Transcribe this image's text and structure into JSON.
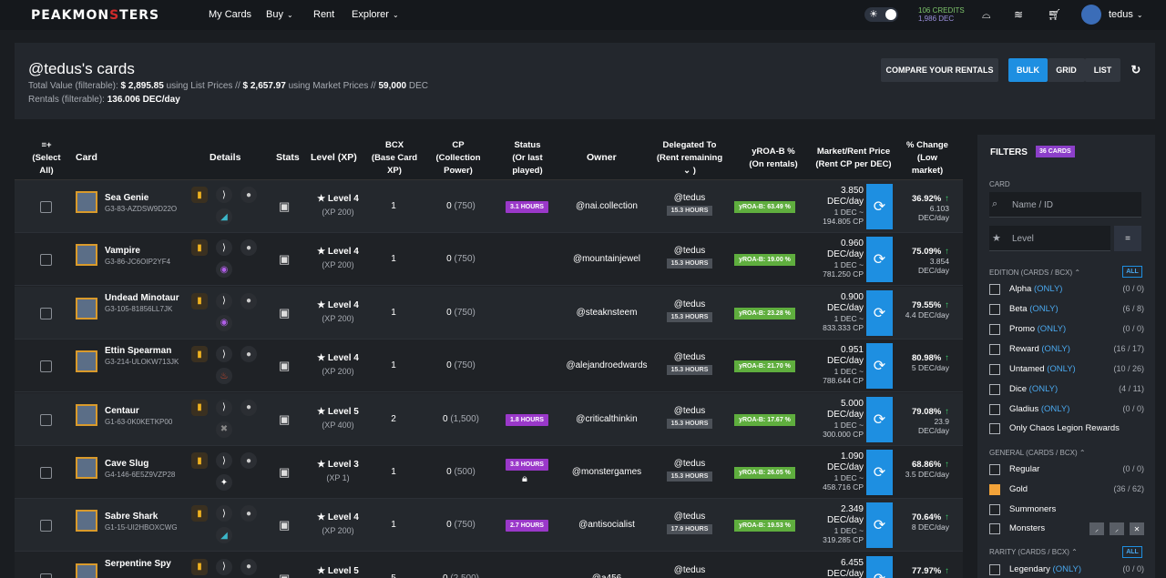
{
  "nav": {
    "logo": "PEAKMONSTERS",
    "logo_pre": "PEAKMON",
    "logo_mid": "S",
    "logo_post": "TERS",
    "my_cards": "My Cards",
    "buy": "Buy",
    "rent": "Rent",
    "explorer": "Explorer",
    "credits": "106 CREDITS",
    "dec": "1,986 DEC",
    "username": "tedus"
  },
  "header": {
    "title": "@tedus's cards",
    "total_label": "Total Value (filterable):",
    "list_value": "$ 2,895.85",
    "list_label": "using List Prices //",
    "market_value": "$ 2,657.97",
    "market_label": "using Market Prices //",
    "dec_value": "59,000",
    "dec_label": "DEC",
    "rentals_label": "Rentals (filterable):",
    "rentals_value": "136.006 DEC/day",
    "compare_btn": "COMPARE YOUR RENTALS",
    "bulk": "BULK",
    "grid": "GRID",
    "list": "LIST"
  },
  "table": {
    "headers": {
      "select": "≡+\n(Select\nAll)",
      "card": "Card",
      "details": "Details",
      "stats": "Stats",
      "level": "Level (XP)",
      "bcx": "BCX\n(Base Card\nXP)",
      "cp": "CP\n(Collection\nPower)",
      "status": "Status\n(Or last\nplayed)",
      "owner": "Owner",
      "delegated": "Delegated To\n(Rent remaining\n⌄ )",
      "yroa": "yROA-B %\n(On rentals)",
      "price": "Market/Rent Price\n(Rent CP per DEC)",
      "change": "% Change\n(Low\nmarket)"
    },
    "rows": [
      {
        "name": "Sea Genie",
        "id": "G3-83-AZDSW9D22O",
        "level": "Level 4",
        "xp": "(XP 200)",
        "bcx": "1",
        "cp": "0",
        "cp2": "(750)",
        "status": "3.1 HOURS",
        "owner": "@nai.collection",
        "deleg": "@tedus",
        "hours": "15.3 HOURS",
        "yroa": "yROA-B: 63.49 %",
        "price": "3.850",
        "p2": "DEC/day",
        "p3": "1 DEC ~",
        "p4": "194.805 CP",
        "pct": "36.92%",
        "pct2": "6.103",
        "pct3": "DEC/day"
      },
      {
        "name": "Vampire",
        "id": "G3-86-JC6OIP2YF4",
        "level": "Level 4",
        "xp": "(XP 200)",
        "bcx": "1",
        "cp": "0",
        "cp2": "(750)",
        "status": "",
        "owner": "@mountainjewel",
        "deleg": "@tedus",
        "hours": "15.3 HOURS",
        "yroa": "yROA-B: 19.00 %",
        "price": "0.960",
        "p2": "DEC/day",
        "p3": "1 DEC ~",
        "p4": "781.250 CP",
        "pct": "75.09%",
        "pct2": "3.854",
        "pct3": "DEC/day"
      },
      {
        "name": "Undead Minotaur",
        "id": "G3-105-81856LL7JK",
        "level": "Level 4",
        "xp": "(XP 200)",
        "bcx": "1",
        "cp": "0",
        "cp2": "(750)",
        "status": "",
        "owner": "@steaknsteem",
        "deleg": "@tedus",
        "hours": "15.3 HOURS",
        "yroa": "yROA-B: 23.28 %",
        "price": "0.900",
        "p2": "DEC/day",
        "p3": "1 DEC ~",
        "p4": "833.333 CP",
        "pct": "79.55%",
        "pct2": "4.4 DEC/day",
        "pct3": ""
      },
      {
        "name": "Ettin Spearman",
        "id": "G3-214-ULOKW713JK",
        "level": "Level 4",
        "xp": "(XP 200)",
        "bcx": "1",
        "cp": "0",
        "cp2": "(750)",
        "status": "",
        "owner": "@alejandroedwards",
        "deleg": "@tedus",
        "hours": "15.3 HOURS",
        "yroa": "yROA-B: 21.70 %",
        "price": "0.951",
        "p2": "DEC/day",
        "p3": "1 DEC ~",
        "p4": "788.644 CP",
        "pct": "80.98%",
        "pct2": "5 DEC/day",
        "pct3": ""
      },
      {
        "name": "Centaur",
        "id": "G1-63-0K0KETKP00",
        "level": "Level 5",
        "xp": "(XP 400)",
        "bcx": "2",
        "cp": "0",
        "cp2": "(1,500)",
        "status": "1.8 HOURS",
        "owner": "@criticalthinkin",
        "deleg": "@tedus",
        "hours": "15.3 HOURS",
        "yroa": "yROA-B: 17.67 %",
        "price": "5.000",
        "p2": "DEC/day",
        "p3": "1 DEC ~",
        "p4": "300.000 CP",
        "pct": "79.08%",
        "pct2": "23.9",
        "pct3": "DEC/day"
      },
      {
        "name": "Cave Slug",
        "id": "G4-146-6E5Z9VZP28",
        "level": "Level 3",
        "xp": "(XP 1)",
        "bcx": "1",
        "cp": "0",
        "cp2": "(500)",
        "status": "3.8 HOURS",
        "owner": "@monstergames",
        "deleg": "@tedus",
        "hours": "15.3 HOURS",
        "yroa": "yROA-B: 26.05 %",
        "price": "1.090",
        "p2": "DEC/day",
        "p3": "1 DEC ~",
        "p4": "458.716 CP",
        "pct": "68.86%",
        "pct2": "3.5 DEC/day",
        "pct3": ""
      },
      {
        "name": "Sabre Shark",
        "id": "G1-15-UI2HBOXCWG",
        "level": "Level 4",
        "xp": "(XP 200)",
        "bcx": "1",
        "cp": "0",
        "cp2": "(750)",
        "status": "2.7 HOURS",
        "owner": "@antisocialist",
        "deleg": "@tedus",
        "hours": "17.9 HOURS",
        "yroa": "yROA-B: 19.53 %",
        "price": "2.349",
        "p2": "DEC/day",
        "p3": "1 DEC ~",
        "p4": "319.285 CP",
        "pct": "70.64%",
        "pct2": "8 DEC/day",
        "pct3": ""
      },
      {
        "name": "Serpentine Spy",
        "id": "",
        "level": "Level 5",
        "xp": "",
        "bcx": "5",
        "cp": "0",
        "cp2": "(2,500)",
        "status": "",
        "owner": "@a456",
        "deleg": "@tedus",
        "hours": "",
        "yroa": "",
        "price": "6.455",
        "p2": "DEC/day",
        "p3": "",
        "p4": "",
        "pct": "77.97%",
        "pct2": "",
        "pct3": ""
      }
    ]
  },
  "filters": {
    "title": "FILTERS",
    "badge": "36 CARDS",
    "card_label": "CARD",
    "name_placeholder": "Name / ID",
    "level_placeholder": "Level",
    "eq": "=",
    "edition_label": "EDITION (CARDS / BCX) ⌃",
    "all": "ALL",
    "only": "(ONLY)",
    "editions": [
      {
        "name": "Alpha",
        "cnt": "(0 / 0)"
      },
      {
        "name": "Beta",
        "cnt": "(6 / 8)"
      },
      {
        "name": "Promo",
        "cnt": "(0 / 0)"
      },
      {
        "name": "Reward",
        "cnt": "(16 / 17)"
      },
      {
        "name": "Untamed",
        "cnt": "(10 / 26)"
      },
      {
        "name": "Dice",
        "cnt": "(4 / 11)"
      },
      {
        "name": "Gladius",
        "cnt": "(0 / 0)"
      }
    ],
    "chaos": "Only Chaos Legion Rewards",
    "general_label": "GENERAL (CARDS / BCX) ⌃",
    "regular": "Regular",
    "regular_cnt": "(0 / 0)",
    "gold": "Gold",
    "gold_cnt": "(36 / 62)",
    "summoners": "Summoners",
    "monsters": "Monsters",
    "rarity_label": "RARITY (CARDS / BCX) ⌃",
    "legendary": "Legendary",
    "legendary_cnt": "(0 / 0)"
  },
  "colors": {
    "accent": "#1e8fe1",
    "status": "#9a38c9",
    "yroa": "#5fae3e",
    "gold": "#f3a339"
  }
}
